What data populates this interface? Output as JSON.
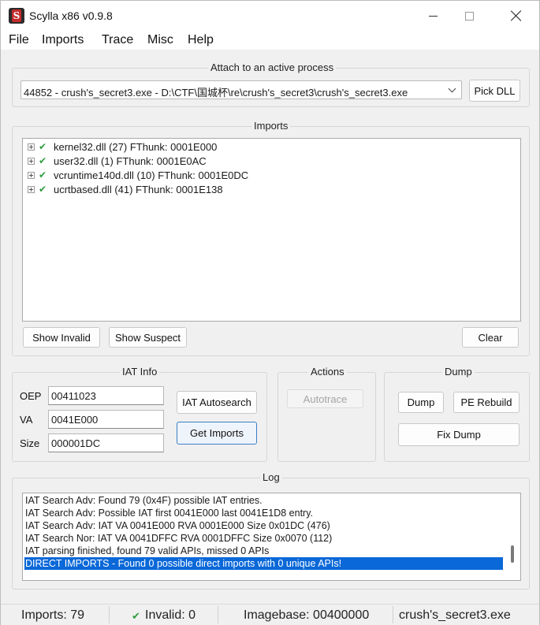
{
  "window": {
    "title": "Scylla x86 v0.9.8"
  },
  "menu": [
    "File",
    "Imports",
    "Trace",
    "Misc",
    "Help"
  ],
  "attach": {
    "group_title": "Attach to an active process",
    "selected_process": "44852 - crush's_secret3.exe - D:\\CTF\\国城杯\\re\\crush's_secret3\\crush's_secret3.exe",
    "pick_dll_label": "Pick DLL"
  },
  "imports": {
    "group_title": "Imports",
    "modules": [
      {
        "label": "kernel32.dll (27) FThunk: 0001E000"
      },
      {
        "label": "user32.dll (1) FThunk: 0001E0AC"
      },
      {
        "label": "vcruntime140d.dll (10) FThunk: 0001E0DC"
      },
      {
        "label": "ucrtbased.dll (41) FThunk: 0001E138"
      }
    ],
    "show_invalid_label": "Show Invalid",
    "show_suspect_label": "Show Suspect",
    "clear_label": "Clear"
  },
  "iat_info": {
    "group_title": "IAT Info",
    "oep_label": "OEP",
    "oep_value": "00411023",
    "va_label": "VA",
    "va_value": "0041E000",
    "size_label": "Size",
    "size_value": "000001DC",
    "autosearch_label": "IAT Autosearch",
    "get_imports_label": "Get Imports"
  },
  "actions": {
    "group_title": "Actions",
    "autotrace_label": "Autotrace"
  },
  "dump": {
    "group_title": "Dump",
    "dump_label": "Dump",
    "pe_rebuild_label": "PE Rebuild",
    "fix_dump_label": "Fix Dump"
  },
  "log": {
    "group_title": "Log",
    "lines": [
      "IAT Search Adv: Found 79 (0x4F) possible IAT entries.",
      "IAT Search Adv: Possible IAT first 0041E000 last 0041E1D8 entry.",
      "IAT Search Adv: IAT VA 0041E000 RVA 0001E000 Size 0x01DC (476)",
      "IAT Search Nor: IAT VA 0041DFFC RVA 0001DFFC Size 0x0070 (112)",
      "IAT parsing finished, found 79 valid APIs, missed 0 APIs",
      "DIRECT IMPORTS - Found 0 possible direct imports with 0 unique APIs!"
    ]
  },
  "status": {
    "imports": "Imports: 79",
    "invalid": "Invalid: 0",
    "imagebase": "Imagebase: 00400000",
    "module": "crush's_secret3.exe"
  },
  "colors": {
    "check_green": "#2e9e3e",
    "selection_blue": "#0a68d8",
    "app_icon_red": "#c42b2b"
  },
  "icons": {
    "app": "scylla-app-icon",
    "tree_expander": "plus-box-icon",
    "valid_check": "check-icon"
  }
}
